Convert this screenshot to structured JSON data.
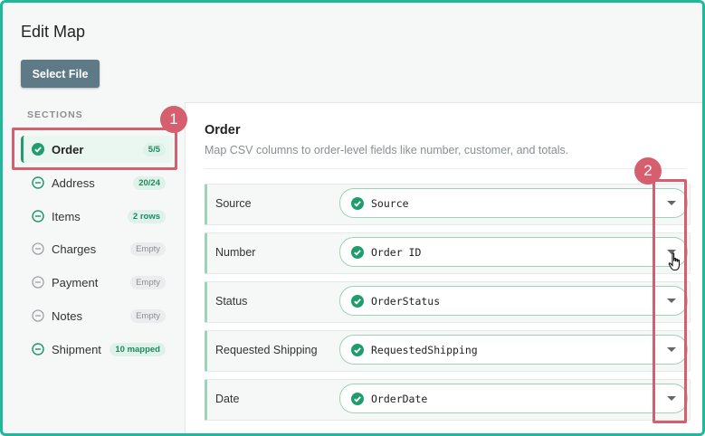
{
  "page": {
    "title": "Edit Map",
    "select_file_label": "Select File"
  },
  "sidebar": {
    "heading": "SECTIONS",
    "items": [
      {
        "label": "Order",
        "badge": "5/5",
        "status": "complete",
        "badge_style": "green"
      },
      {
        "label": "Address",
        "badge": "20/24",
        "status": "partial",
        "badge_style": "green"
      },
      {
        "label": "Items",
        "badge": "2 rows",
        "status": "partial",
        "badge_style": "green"
      },
      {
        "label": "Charges",
        "badge": "Empty",
        "status": "empty",
        "badge_style": "grey"
      },
      {
        "label": "Payment",
        "badge": "Empty",
        "status": "empty",
        "badge_style": "grey"
      },
      {
        "label": "Notes",
        "badge": "Empty",
        "status": "empty",
        "badge_style": "grey"
      },
      {
        "label": "Shipment",
        "badge": "10 mapped",
        "status": "partial",
        "badge_style": "green"
      }
    ]
  },
  "main": {
    "title": "Order",
    "description": "Map CSV columns to order-level fields like number, customer, and totals.",
    "fields": [
      {
        "label": "Source",
        "value": "Source"
      },
      {
        "label": "Number",
        "value": "Order ID"
      },
      {
        "label": "Status",
        "value": "OrderStatus"
      },
      {
        "label": "Requested Shipping",
        "value": "RequestedShipping"
      },
      {
        "label": "Date",
        "value": "OrderDate"
      }
    ]
  },
  "callouts": [
    "1",
    "2"
  ],
  "colors": {
    "accent": "#1f9d6c",
    "callout": "#d55f6e",
    "button": "#5f7a87",
    "frame": "#1fb89a"
  }
}
